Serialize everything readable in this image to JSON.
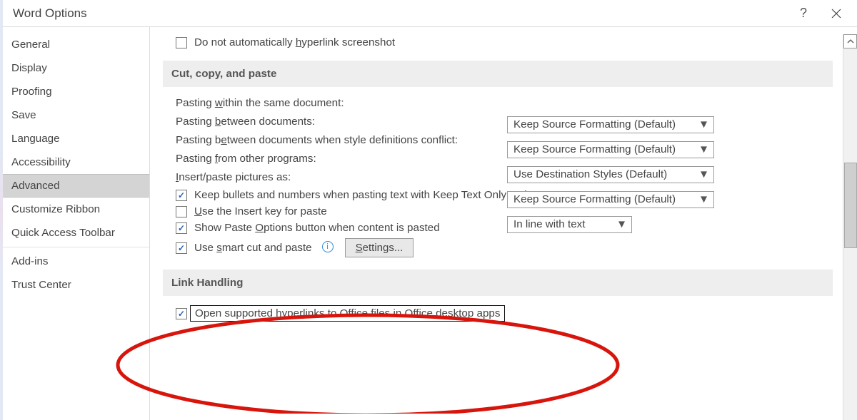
{
  "dialog": {
    "title": "Word Options",
    "help_label": "?",
    "close_label": "Close"
  },
  "sidebar": {
    "items": [
      {
        "label": "General"
      },
      {
        "label": "Display"
      },
      {
        "label": "Proofing"
      },
      {
        "label": "Save"
      },
      {
        "label": "Language"
      },
      {
        "label": "Accessibility"
      },
      {
        "label": "Advanced",
        "selected": true
      },
      {
        "label": "Customize Ribbon"
      },
      {
        "label": "Quick Access Toolbar"
      },
      {
        "label": "Add-ins"
      },
      {
        "label": "Trust Center"
      }
    ]
  },
  "top_checkbox": {
    "checked": false,
    "label_pre": "Do not automatically ",
    "label_u": "h",
    "label_post": "yperlink screenshot"
  },
  "sections": {
    "cut_copy_paste": {
      "header": "Cut, copy, and paste"
    },
    "link_handling": {
      "header": "Link Handling"
    }
  },
  "paste_rows": {
    "within": {
      "pre": "Pasting ",
      "u": "w",
      "post": "ithin the same document:"
    },
    "between": {
      "pre": "Pasting ",
      "u": "b",
      "post": "etween documents:"
    },
    "between_conf": {
      "pre": "Pasting b",
      "u": "e",
      "post": "tween documents when style definitions conflict:"
    },
    "other": {
      "pre": "Pasting ",
      "u": "f",
      "post": "rom other programs:"
    },
    "insert_pic": {
      "pre": "",
      "u": "I",
      "post": "nsert/paste pictures as:"
    }
  },
  "dropdowns": {
    "within": {
      "value": "Keep Source Formatting (Default)"
    },
    "between": {
      "value": "Keep Source Formatting (Default)"
    },
    "between_conf": {
      "value": "Use Destination Styles (Default)"
    },
    "other": {
      "value": "Keep Source Formatting (Default)"
    },
    "insert_pic": {
      "value": "In line with text"
    }
  },
  "check_rows": {
    "keep_bullets": {
      "checked": true,
      "text": "Keep bullets and numbers when pasting text with Keep Text Only option"
    },
    "use_insert": {
      "checked": false,
      "pre": "",
      "u": "U",
      "post": "se the Insert key for paste"
    },
    "show_paste": {
      "checked": true,
      "pre": "Show Paste ",
      "u": "O",
      "post": "ptions button when content is pasted"
    },
    "smart_cut": {
      "checked": true,
      "pre": "Use ",
      "u": "s",
      "post": "mart cut and paste"
    },
    "open_links": {
      "checked": true,
      "text": "Open supported hyperlinks to Office files in Office desktop apps"
    }
  },
  "buttons": {
    "settings": "Settings..."
  }
}
